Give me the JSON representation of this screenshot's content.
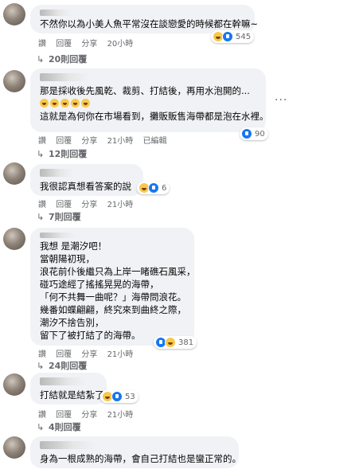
{
  "comments": [
    {
      "lines": [
        "不然你以為小美人魚平常沒在談戀愛的時候都在幹嘛~"
      ],
      "meta": {
        "like": "讚",
        "reply": "回覆",
        "share": "分享",
        "time": "20小時"
      },
      "reactions": {
        "icons": [
          "haha-icon",
          "like-icon"
        ],
        "count": "545"
      },
      "replies_label": "20則回覆"
    },
    {
      "lines": [
        "那是採收後先風乾、裁剪、打結後，再用水泡開的...",
        "",
        "這就是為何你在市場看到，攤販販售海帶都是泡在水裡。"
      ],
      "emoji_line_count": 5,
      "meta": {
        "like": "讚",
        "reply": "回覆",
        "share": "分享",
        "time": "21小時",
        "edited": "已編輯"
      },
      "reactions": {
        "icons": [
          "like-icon"
        ],
        "count": "90"
      },
      "replies_label": "12則回覆",
      "more_label": "···"
    },
    {
      "lines": [
        "我很認真想看答案的說"
      ],
      "meta": {
        "like": "讚",
        "reply": "回覆",
        "share": "分享",
        "time": "21小時"
      },
      "reactions": {
        "icons": [
          "haha-icon",
          "like-icon"
        ],
        "count": "6"
      },
      "replies_label": "7則回覆"
    },
    {
      "lines": [
        "我想 是潮汐吧！",
        "當朝陽初現，",
        "浪花前仆後繼只為上岸一睹礁石風采，",
        "碰巧途經了搖搖晃晃的海帶，",
        "「何不共舞一曲呢？」海帶問浪花。",
        "幾番如蝶翩翩，終究來到曲終之際，",
        "潮汐不捨告別，",
        "留下了被打結了的海帶。"
      ],
      "meta": {
        "like": "讚",
        "reply": "回覆",
        "share": "分享",
        "time": "21小時"
      },
      "reactions": {
        "icons": [
          "like-icon",
          "haha-icon"
        ],
        "count": "381"
      },
      "replies_label": "24則回覆"
    },
    {
      "lines": [
        "打結就是結紮了"
      ],
      "meta": {
        "like": "讚",
        "reply": "回覆",
        "share": "分享",
        "time": "21小時"
      },
      "reactions": {
        "icons": [
          "haha-icon",
          "like-icon"
        ],
        "count": "53"
      },
      "replies_label": "4則回覆"
    },
    {
      "lines": [
        "身為一根成熟的海帶，會自己打結也是蠻正常的。"
      ]
    }
  ]
}
